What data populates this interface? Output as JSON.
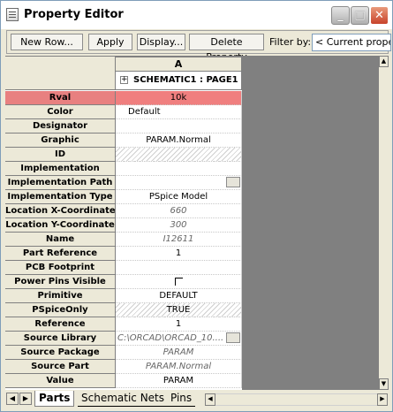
{
  "window": {
    "title": "Property Editor",
    "controls": {
      "minimize": "_",
      "maximize": "□",
      "close": "✕"
    }
  },
  "toolbar": {
    "new_row": "New Row...",
    "apply": "Apply",
    "display": "Display...",
    "delete_property": "Delete Property",
    "filter_label": "Filter by:",
    "filter_value": "< Current properties >"
  },
  "grid": {
    "column_header": "A",
    "object_name": "SCHEMATIC1 : PAGE1",
    "rows": [
      {
        "name": "Rval",
        "value": "10k"
      },
      {
        "name": "Color",
        "value": "Default"
      },
      {
        "name": "Designator",
        "value": ""
      },
      {
        "name": "Graphic",
        "value": "PARAM.Normal"
      },
      {
        "name": "ID",
        "value": ""
      },
      {
        "name": "Implementation",
        "value": ""
      },
      {
        "name": "Implementation Path",
        "value": ""
      },
      {
        "name": "Implementation Type",
        "value": "PSpice Model"
      },
      {
        "name": "Location X-Coordinate",
        "value": "660"
      },
      {
        "name": "Location Y-Coordinate",
        "value": "300"
      },
      {
        "name": "Name",
        "value": "I12611"
      },
      {
        "name": "Part Reference",
        "value": "1"
      },
      {
        "name": "PCB Footprint",
        "value": ""
      },
      {
        "name": "Power Pins Visible",
        "value": ""
      },
      {
        "name": "Primitive",
        "value": "DEFAULT"
      },
      {
        "name": "PSpiceOnly",
        "value": "TRUE"
      },
      {
        "name": "Reference",
        "value": "1"
      },
      {
        "name": "Source Library",
        "value": "C:\\ORCAD\\ORCAD_10...."
      },
      {
        "name": "Source Package",
        "value": "PARAM"
      },
      {
        "name": "Source Part",
        "value": "PARAM.Normal"
      },
      {
        "name": "Value",
        "value": "PARAM"
      }
    ]
  },
  "tabs": [
    "Parts",
    "Schematic Nets",
    "Pins"
  ],
  "colors": {
    "selected_row": "#f07f7f",
    "header_gray": "#ece9d8",
    "empty_area": "#808080"
  }
}
